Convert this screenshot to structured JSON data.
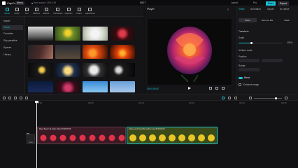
{
  "topbar": {
    "app_name": "CapCut",
    "menu_label": "Menu",
    "autosave": "Auto saved: 18:51:35",
    "doc_title": "0627",
    "layout_label": "Layout",
    "pro_label": "Pro",
    "share_label": "Share",
    "export_label": "Export",
    "accent": "#19c2d6"
  },
  "toolbar": {
    "tools": [
      {
        "label": "Media",
        "icon": "media-icon"
      },
      {
        "label": "Audio",
        "icon": "audio-icon"
      },
      {
        "label": "Text",
        "icon": "text-icon"
      },
      {
        "label": "Stickers",
        "icon": "sticker-icon"
      },
      {
        "label": "Effects",
        "icon": "effects-icon"
      },
      {
        "label": "Transitions",
        "icon": "transition-icon"
      },
      {
        "label": "Captions",
        "icon": "captions-icon"
      },
      {
        "label": "Filters",
        "icon": "filter-icon"
      },
      {
        "label": "Adjustment",
        "icon": "adjust-icon"
      }
    ]
  },
  "leftnav": {
    "items": [
      "Import",
      "Yours",
      "Favorites",
      "Sky paradise",
      "Spaces",
      "Library"
    ]
  },
  "player": {
    "title": "Player",
    "current_time": "00:00:00:00"
  },
  "inspector": {
    "tabs": [
      "Video",
      "Animation",
      "Adjust",
      "AI stylize"
    ],
    "subtabs": [
      "Basic",
      "Remove BG",
      "Mask"
    ],
    "transform_label": "Transform",
    "scale_label": "Scale",
    "scale_value": "100%",
    "uniform_scale_label": "Uniform scale",
    "position_label": "Position",
    "rotate_label": "Rotate",
    "blend_label": "Blend",
    "enhance_label": "Enhance image"
  },
  "timeline": {
    "ruler": [
      "00:00",
      "|00:05",
      "|00:10",
      "|00:15",
      "|00:20",
      "|00:25",
      "|00:30"
    ],
    "cover_label": "Cover",
    "clip1_title": "Rose flower 4k stock video  00:00:05:06",
    "clip2_title": "Close-up of beautiful yellow rose  00:00:09:21"
  }
}
